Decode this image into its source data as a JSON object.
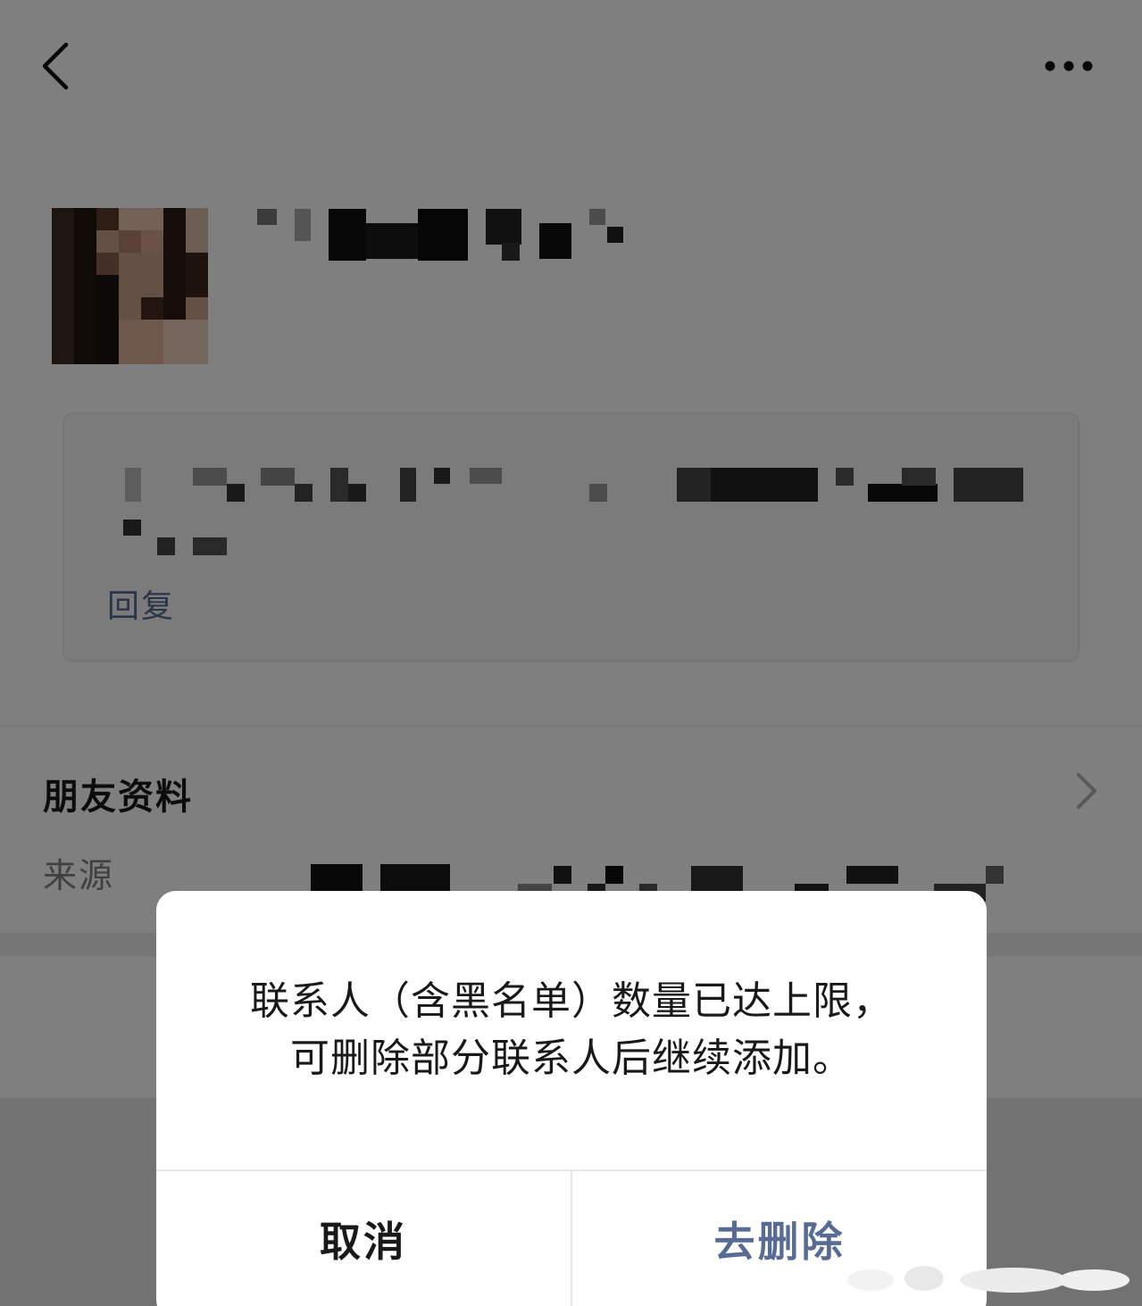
{
  "nav": {
    "back_icon": "chevron-left-icon",
    "more_icon": "more-dots-icon"
  },
  "greeting": {
    "reply_label": "回复"
  },
  "friend_info": {
    "title": "朋友资料",
    "source_label": "来源",
    "chevron_icon": "chevron-right-icon"
  },
  "dialog": {
    "message_lines": [
      "联系人（含黑名单）数量已达上限，",
      "可删除部分联系人后继续添加。"
    ],
    "cancel_label": "取消",
    "confirm_label": "去删除"
  },
  "colors": {
    "link": "#576b95",
    "text": "#191919",
    "secondary_text": "#808080",
    "mask": "rgba(0,0,0,0.5)"
  }
}
